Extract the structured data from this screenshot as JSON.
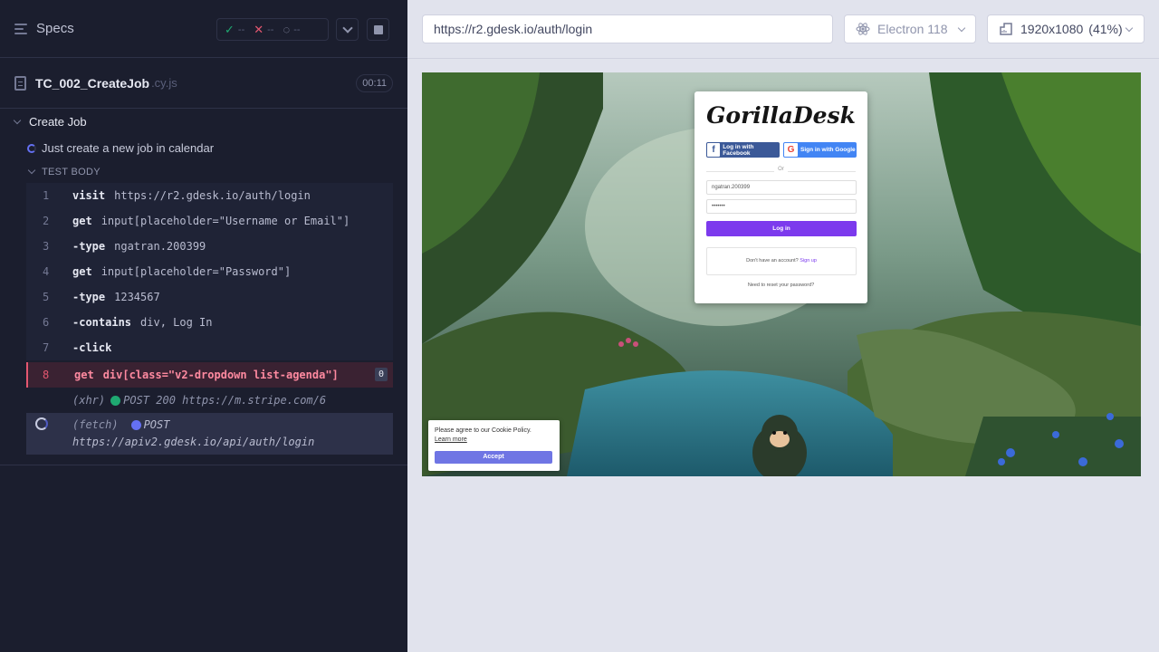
{
  "reporter": {
    "specs_label": "Specs",
    "stats": {
      "passed": "--",
      "failed": "--",
      "pending": "--"
    },
    "spec_file": {
      "name": "TC_002_CreateJob",
      "ext": ".cy.js",
      "duration": "00:11"
    },
    "suite_title": "Create Job",
    "test_title": "Just create a new job in calendar",
    "body_label": "TEST BODY",
    "commands": [
      {
        "num": "1",
        "name": "visit",
        "message": "https://r2.gdesk.io/auth/login"
      },
      {
        "num": "2",
        "name": "get",
        "message": "input[placeholder=\"Username or Email\"]"
      },
      {
        "num": "3",
        "name": "-type",
        "message": "ngatran.200399"
      },
      {
        "num": "4",
        "name": "get",
        "message": "input[placeholder=\"Password\"]"
      },
      {
        "num": "5",
        "name": "-type",
        "message": "1234567"
      },
      {
        "num": "6",
        "name": "-contains",
        "message": "div, Log In"
      },
      {
        "num": "7",
        "name": "-click",
        "message": ""
      },
      {
        "num": "8",
        "name": "get",
        "message": "div[class=\"v2-dropdown list-agenda\"]",
        "badge": "0"
      }
    ],
    "xhr": {
      "type": "(xhr)",
      "status": "POST 200 https://m.stripe.com/6",
      "dot_color": "#1fa971"
    },
    "fetch": {
      "type": "(fetch)",
      "method": "POST",
      "url": "https://apiv2.gdesk.io/api/auth/login",
      "dot_color": "#6470f3"
    }
  },
  "aut": {
    "url": "https://r2.gdesk.io/auth/login",
    "browser": "Electron 118",
    "viewport": "1920x1080",
    "scale": "(41%)",
    "page": {
      "logo": "GorillaDesk",
      "facebook_btn": "Log in with Facebook",
      "google_btn": "Sign in with Google",
      "or_text": "Or",
      "username_value": "ngatran.200399",
      "password_value": "•••••••",
      "login_btn": "Log in",
      "no_account": "Don't have an account?",
      "signup_link": "Sign up",
      "reset_link": "Need to reset your password?",
      "cookie_text": "Please agree to our Cookie Policy.",
      "cookie_link": "Learn more",
      "cookie_accept": "Accept"
    }
  },
  "colors": {
    "panel_bg": "#1b1e2e",
    "fail": "#e45770",
    "pass": "#1fa971",
    "accent": "#6470f3",
    "brand_purple": "#7c3aed"
  }
}
